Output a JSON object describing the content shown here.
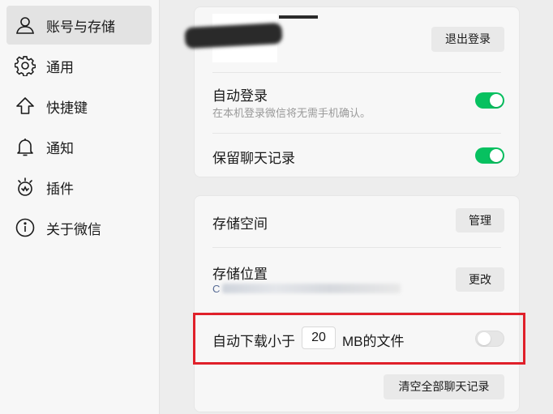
{
  "sidebar": {
    "items": [
      {
        "label": "账号与存储",
        "icon": "user-icon",
        "active": true
      },
      {
        "label": "通用",
        "icon": "gear-icon",
        "active": false
      },
      {
        "label": "快捷键",
        "icon": "arrow-up-icon",
        "active": false
      },
      {
        "label": "通知",
        "icon": "bell-icon",
        "active": false
      },
      {
        "label": "插件",
        "icon": "plugin-icon",
        "active": false
      },
      {
        "label": "关于微信",
        "icon": "info-icon",
        "active": false
      }
    ]
  },
  "account": {
    "logout_label": "退出登录",
    "auto_login": {
      "title": "自动登录",
      "subtitle": "在本机登录微信将无需手机确认。",
      "enabled": true
    },
    "keep_history": {
      "title": "保留聊天记录",
      "enabled": true
    }
  },
  "storage": {
    "space": {
      "title": "存储空间",
      "button": "管理"
    },
    "location": {
      "title": "存储位置",
      "path_prefix": "C",
      "button": "更改"
    },
    "auto_download": {
      "prefix": "自动下载小于",
      "size_value": "20",
      "suffix": "MB的文件",
      "enabled": false
    },
    "clear_button": "清空全部聊天记录"
  },
  "colors": {
    "accent": "#07c160",
    "highlight": "#e0202a"
  }
}
